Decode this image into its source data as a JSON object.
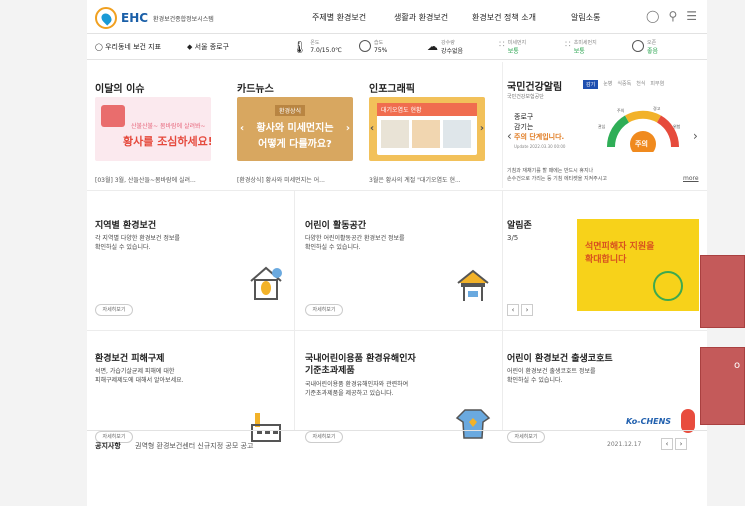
{
  "header": {
    "logo_text": "EHC",
    "logo_sub": "환경보건종합정보시스템",
    "nav": [
      "주제별 환경보건",
      "생활과 환경보건",
      "환경보건 정책 소개",
      "알림소통"
    ]
  },
  "infobar": {
    "location_label": "우리동네 보건 지표",
    "region": "서울 종로구",
    "temp_label": "온도",
    "temp_value": "7.0/15.0℃",
    "humidity_label": "습도",
    "humidity_value": "75%",
    "rain_label": "강수량",
    "rain_value": "강수없음",
    "dust_label": "미세먼지",
    "dust_value": "보통",
    "ultra_dust_label": "초미세먼지",
    "ultra_dust_value": "보통",
    "ozone_label": "오존",
    "ozone_value": "좋음"
  },
  "issue": {
    "title": "이달의 이슈",
    "thumb_line1": "산불산불~ 몸바람에 살려봐~",
    "thumb_line2": "황사를 조심하세요!",
    "caption": "[03월] 3월, 산들산들~봄바람에 실려..."
  },
  "cardnews": {
    "title": "카드뉴스",
    "thumb_text1": "환경상식",
    "thumb_text2": "황사와 미세먼지는",
    "thumb_text3": "어떻게 다를까요?",
    "caption": "[환경상식] 황사와 미세먼지는 어..."
  },
  "infographic": {
    "title": "인포그래픽",
    "thumb_text": "대기오염도 현황",
    "caption": "3월은 황사의 계절 \"대기오염도 현..."
  },
  "health_alert": {
    "title": "국민건강알림",
    "sub": "국민건강보험공단",
    "tabs": [
      "감기",
      "눈병",
      "식중독",
      "천식",
      "피부염"
    ],
    "region": "종로구",
    "disease": "감기는",
    "level_text": "주의 단계입니다.",
    "update": "Update 2022.03.30 00:00",
    "gauge_center": "주의",
    "gauge_labels": [
      "관심",
      "주의",
      "경고",
      "위험"
    ],
    "tip1": "기침과 재채기를 할 때에는 반드시 휴지나",
    "tip2": "손수건으로 가리는 등 기침 에티켓을 지켜주시고",
    "more": "more"
  },
  "cards": {
    "regional": {
      "title": "지역별 환경보건",
      "desc1": "각 지역별 다양한 환경보건 정보를",
      "desc2": "확인하실 수 있습니다.",
      "btn": "자세히보기"
    },
    "kids_space": {
      "title": "어린이 활동공간",
      "desc1": "다양한 어린이활동공간 환경보건 정보를",
      "desc2": "확인하실 수 있습니다.",
      "btn": "자세히보기"
    },
    "alarm": {
      "title": "알림존",
      "counter": "3/5",
      "banner1": "석면피해자 지원을",
      "banner2": "확대합니다"
    },
    "relief": {
      "title": "환경보건 피해구제",
      "desc1": "석면, 가습기살균제 피해에 대한",
      "desc2": "피해구제제도에 대해서 알아보세요.",
      "btn": "자세히보기"
    },
    "kids_products": {
      "title1": "국내어린이용품 환경유해인자",
      "title2": "기준초과제품",
      "desc1": "국내어린이용품 환경유해인자와 관련하여",
      "desc2": "기준초과제품을 제공하고 있습니다.",
      "btn": "자세히보기"
    },
    "cohort": {
      "title": "어린이 환경보건 출생코호트",
      "desc1": "어린이 환경보건 출생코호트 정보를",
      "desc2": "확인하실 수 있습니다.",
      "btn": "자세히보기",
      "logo": "Ko-CHENS"
    }
  },
  "notice": {
    "label": "공지사항",
    "text": "권역형 환경보건센터 신규지정 공모 공고",
    "date": "2021.12.17"
  },
  "overlay": {
    "partial_text": "o"
  }
}
